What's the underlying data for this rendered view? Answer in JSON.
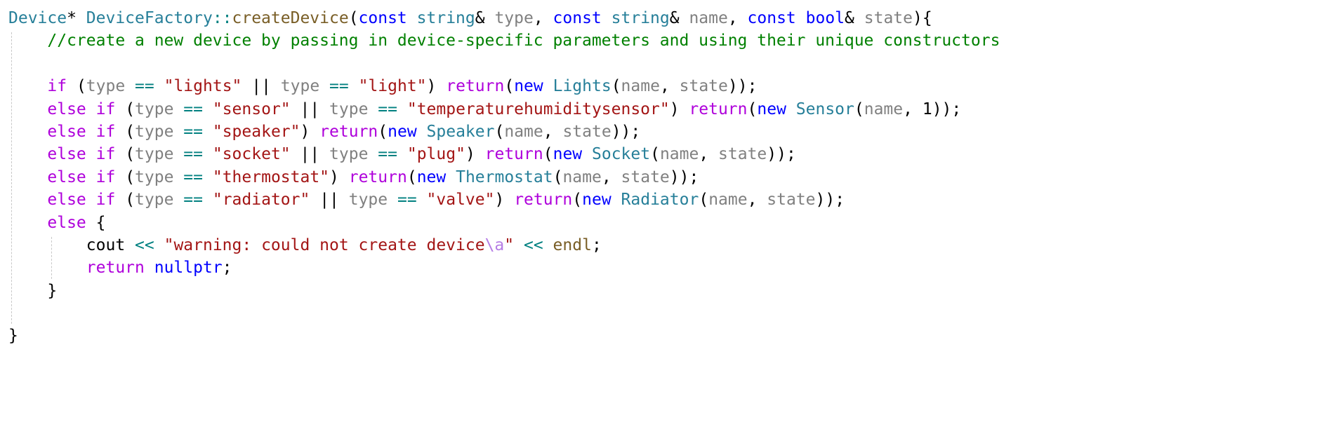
{
  "editor": {
    "lines": [
      [
        {
          "t": "Device",
          "c": "ty"
        },
        {
          "t": "* ",
          "c": "pl"
        },
        {
          "t": "DeviceFactory",
          "c": "ty"
        },
        {
          "t": "::",
          "c": "op"
        },
        {
          "t": "createDevice",
          "c": "fn"
        },
        {
          "t": "(",
          "c": "pl"
        },
        {
          "t": "const",
          "c": "kw"
        },
        {
          "t": " ",
          "c": "pl"
        },
        {
          "t": "string",
          "c": "ty"
        },
        {
          "t": "& ",
          "c": "pl"
        },
        {
          "t": "type",
          "c": "pa"
        },
        {
          "t": ", ",
          "c": "pl"
        },
        {
          "t": "const",
          "c": "kw"
        },
        {
          "t": " ",
          "c": "pl"
        },
        {
          "t": "string",
          "c": "ty"
        },
        {
          "t": "& ",
          "c": "pl"
        },
        {
          "t": "name",
          "c": "pa"
        },
        {
          "t": ", ",
          "c": "pl"
        },
        {
          "t": "const",
          "c": "kw"
        },
        {
          "t": " ",
          "c": "pl"
        },
        {
          "t": "bool",
          "c": "kw"
        },
        {
          "t": "& ",
          "c": "pl"
        },
        {
          "t": "state",
          "c": "pa"
        },
        {
          "t": "){",
          "c": "pl"
        }
      ],
      [
        {
          "t": "    ",
          "c": "pl"
        },
        {
          "t": "//create a new device by passing in device-specific parameters and using their unique constructors",
          "c": "cm"
        }
      ],
      [],
      [
        {
          "t": "    ",
          "c": "pl"
        },
        {
          "t": "if",
          "c": "ctl"
        },
        {
          "t": " (",
          "c": "pl"
        },
        {
          "t": "type",
          "c": "pa"
        },
        {
          "t": " ",
          "c": "pl"
        },
        {
          "t": "==",
          "c": "op"
        },
        {
          "t": " ",
          "c": "pl"
        },
        {
          "t": "\"lights\"",
          "c": "st"
        },
        {
          "t": " || ",
          "c": "pl"
        },
        {
          "t": "type",
          "c": "pa"
        },
        {
          "t": " ",
          "c": "pl"
        },
        {
          "t": "==",
          "c": "op"
        },
        {
          "t": " ",
          "c": "pl"
        },
        {
          "t": "\"light\"",
          "c": "st"
        },
        {
          "t": ") ",
          "c": "pl"
        },
        {
          "t": "return",
          "c": "ctl"
        },
        {
          "t": "(",
          "c": "pl"
        },
        {
          "t": "new",
          "c": "kw"
        },
        {
          "t": " ",
          "c": "pl"
        },
        {
          "t": "Lights",
          "c": "ty"
        },
        {
          "t": "(",
          "c": "pl"
        },
        {
          "t": "name",
          "c": "pa"
        },
        {
          "t": ", ",
          "c": "pl"
        },
        {
          "t": "state",
          "c": "pa"
        },
        {
          "t": "));",
          "c": "pl"
        }
      ],
      [
        {
          "t": "    ",
          "c": "pl"
        },
        {
          "t": "else",
          "c": "ctl"
        },
        {
          "t": " ",
          "c": "pl"
        },
        {
          "t": "if",
          "c": "ctl"
        },
        {
          "t": " (",
          "c": "pl"
        },
        {
          "t": "type",
          "c": "pa"
        },
        {
          "t": " ",
          "c": "pl"
        },
        {
          "t": "==",
          "c": "op"
        },
        {
          "t": " ",
          "c": "pl"
        },
        {
          "t": "\"sensor\"",
          "c": "st"
        },
        {
          "t": " || ",
          "c": "pl"
        },
        {
          "t": "type",
          "c": "pa"
        },
        {
          "t": " ",
          "c": "pl"
        },
        {
          "t": "==",
          "c": "op"
        },
        {
          "t": " ",
          "c": "pl"
        },
        {
          "t": "\"temperaturehumiditysensor\"",
          "c": "st"
        },
        {
          "t": ") ",
          "c": "pl"
        },
        {
          "t": "return",
          "c": "ctl"
        },
        {
          "t": "(",
          "c": "pl"
        },
        {
          "t": "new",
          "c": "kw"
        },
        {
          "t": " ",
          "c": "pl"
        },
        {
          "t": "Sensor",
          "c": "ty"
        },
        {
          "t": "(",
          "c": "pl"
        },
        {
          "t": "name",
          "c": "pa"
        },
        {
          "t": ", ",
          "c": "pl"
        },
        {
          "t": "1",
          "c": "num"
        },
        {
          "t": "));",
          "c": "pl"
        }
      ],
      [
        {
          "t": "    ",
          "c": "pl"
        },
        {
          "t": "else",
          "c": "ctl"
        },
        {
          "t": " ",
          "c": "pl"
        },
        {
          "t": "if",
          "c": "ctl"
        },
        {
          "t": " (",
          "c": "pl"
        },
        {
          "t": "type",
          "c": "pa"
        },
        {
          "t": " ",
          "c": "pl"
        },
        {
          "t": "==",
          "c": "op"
        },
        {
          "t": " ",
          "c": "pl"
        },
        {
          "t": "\"speaker\"",
          "c": "st"
        },
        {
          "t": ") ",
          "c": "pl"
        },
        {
          "t": "return",
          "c": "ctl"
        },
        {
          "t": "(",
          "c": "pl"
        },
        {
          "t": "new",
          "c": "kw"
        },
        {
          "t": " ",
          "c": "pl"
        },
        {
          "t": "Speaker",
          "c": "ty"
        },
        {
          "t": "(",
          "c": "pl"
        },
        {
          "t": "name",
          "c": "pa"
        },
        {
          "t": ", ",
          "c": "pl"
        },
        {
          "t": "state",
          "c": "pa"
        },
        {
          "t": "));",
          "c": "pl"
        }
      ],
      [
        {
          "t": "    ",
          "c": "pl"
        },
        {
          "t": "else",
          "c": "ctl"
        },
        {
          "t": " ",
          "c": "pl"
        },
        {
          "t": "if",
          "c": "ctl"
        },
        {
          "t": " (",
          "c": "pl"
        },
        {
          "t": "type",
          "c": "pa"
        },
        {
          "t": " ",
          "c": "pl"
        },
        {
          "t": "==",
          "c": "op"
        },
        {
          "t": " ",
          "c": "pl"
        },
        {
          "t": "\"socket\"",
          "c": "st"
        },
        {
          "t": " || ",
          "c": "pl"
        },
        {
          "t": "type",
          "c": "pa"
        },
        {
          "t": " ",
          "c": "pl"
        },
        {
          "t": "==",
          "c": "op"
        },
        {
          "t": " ",
          "c": "pl"
        },
        {
          "t": "\"plug\"",
          "c": "st"
        },
        {
          "t": ") ",
          "c": "pl"
        },
        {
          "t": "return",
          "c": "ctl"
        },
        {
          "t": "(",
          "c": "pl"
        },
        {
          "t": "new",
          "c": "kw"
        },
        {
          "t": " ",
          "c": "pl"
        },
        {
          "t": "Socket",
          "c": "ty"
        },
        {
          "t": "(",
          "c": "pl"
        },
        {
          "t": "name",
          "c": "pa"
        },
        {
          "t": ", ",
          "c": "pl"
        },
        {
          "t": "state",
          "c": "pa"
        },
        {
          "t": "));",
          "c": "pl"
        }
      ],
      [
        {
          "t": "    ",
          "c": "pl"
        },
        {
          "t": "else",
          "c": "ctl"
        },
        {
          "t": " ",
          "c": "pl"
        },
        {
          "t": "if",
          "c": "ctl"
        },
        {
          "t": " (",
          "c": "pl"
        },
        {
          "t": "type",
          "c": "pa"
        },
        {
          "t": " ",
          "c": "pl"
        },
        {
          "t": "==",
          "c": "op"
        },
        {
          "t": " ",
          "c": "pl"
        },
        {
          "t": "\"thermostat\"",
          "c": "st"
        },
        {
          "t": ") ",
          "c": "pl"
        },
        {
          "t": "return",
          "c": "ctl"
        },
        {
          "t": "(",
          "c": "pl"
        },
        {
          "t": "new",
          "c": "kw"
        },
        {
          "t": " ",
          "c": "pl"
        },
        {
          "t": "Thermostat",
          "c": "ty"
        },
        {
          "t": "(",
          "c": "pl"
        },
        {
          "t": "name",
          "c": "pa"
        },
        {
          "t": ", ",
          "c": "pl"
        },
        {
          "t": "state",
          "c": "pa"
        },
        {
          "t": "));",
          "c": "pl"
        }
      ],
      [
        {
          "t": "    ",
          "c": "pl"
        },
        {
          "t": "else",
          "c": "ctl"
        },
        {
          "t": " ",
          "c": "pl"
        },
        {
          "t": "if",
          "c": "ctl"
        },
        {
          "t": " (",
          "c": "pl"
        },
        {
          "t": "type",
          "c": "pa"
        },
        {
          "t": " ",
          "c": "pl"
        },
        {
          "t": "==",
          "c": "op"
        },
        {
          "t": " ",
          "c": "pl"
        },
        {
          "t": "\"radiator\"",
          "c": "st"
        },
        {
          "t": " || ",
          "c": "pl"
        },
        {
          "t": "type",
          "c": "pa"
        },
        {
          "t": " ",
          "c": "pl"
        },
        {
          "t": "==",
          "c": "op"
        },
        {
          "t": " ",
          "c": "pl"
        },
        {
          "t": "\"valve\"",
          "c": "st"
        },
        {
          "t": ") ",
          "c": "pl"
        },
        {
          "t": "return",
          "c": "ctl"
        },
        {
          "t": "(",
          "c": "pl"
        },
        {
          "t": "new",
          "c": "kw"
        },
        {
          "t": " ",
          "c": "pl"
        },
        {
          "t": "Radiator",
          "c": "ty"
        },
        {
          "t": "(",
          "c": "pl"
        },
        {
          "t": "name",
          "c": "pa"
        },
        {
          "t": ", ",
          "c": "pl"
        },
        {
          "t": "state",
          "c": "pa"
        },
        {
          "t": "));",
          "c": "pl"
        }
      ],
      [
        {
          "t": "    ",
          "c": "pl"
        },
        {
          "t": "else",
          "c": "ctl"
        },
        {
          "t": " {",
          "c": "pl"
        }
      ],
      [
        {
          "t": "        ",
          "c": "pl"
        },
        {
          "t": "cout",
          "c": "pl"
        },
        {
          "t": " ",
          "c": "pl"
        },
        {
          "t": "<<",
          "c": "op"
        },
        {
          "t": " ",
          "c": "pl"
        },
        {
          "t": "\"warning: could not create device",
          "c": "st"
        },
        {
          "t": "\\a",
          "c": "esc"
        },
        {
          "t": "\"",
          "c": "st"
        },
        {
          "t": " ",
          "c": "pl"
        },
        {
          "t": "<<",
          "c": "op"
        },
        {
          "t": " ",
          "c": "pl"
        },
        {
          "t": "endl",
          "c": "fn"
        },
        {
          "t": ";",
          "c": "pl"
        }
      ],
      [
        {
          "t": "        ",
          "c": "pl"
        },
        {
          "t": "return",
          "c": "ctl"
        },
        {
          "t": " ",
          "c": "pl"
        },
        {
          "t": "nullptr",
          "c": "kw"
        },
        {
          "t": ";",
          "c": "pl"
        }
      ],
      [
        {
          "t": "    ",
          "c": "pl"
        },
        {
          "t": "}",
          "c": "pl"
        }
      ],
      [],
      [
        {
          "t": "}",
          "c": "pl"
        }
      ]
    ]
  },
  "colors": {
    "background": "#ffffff",
    "type": "#267f99",
    "keyword": "#0000ff",
    "control": "#af00db",
    "function": "#795e26",
    "parameter": "#808080",
    "comment": "#008000",
    "string": "#a31515",
    "operator": "#008080",
    "escape": "#b57de5"
  }
}
